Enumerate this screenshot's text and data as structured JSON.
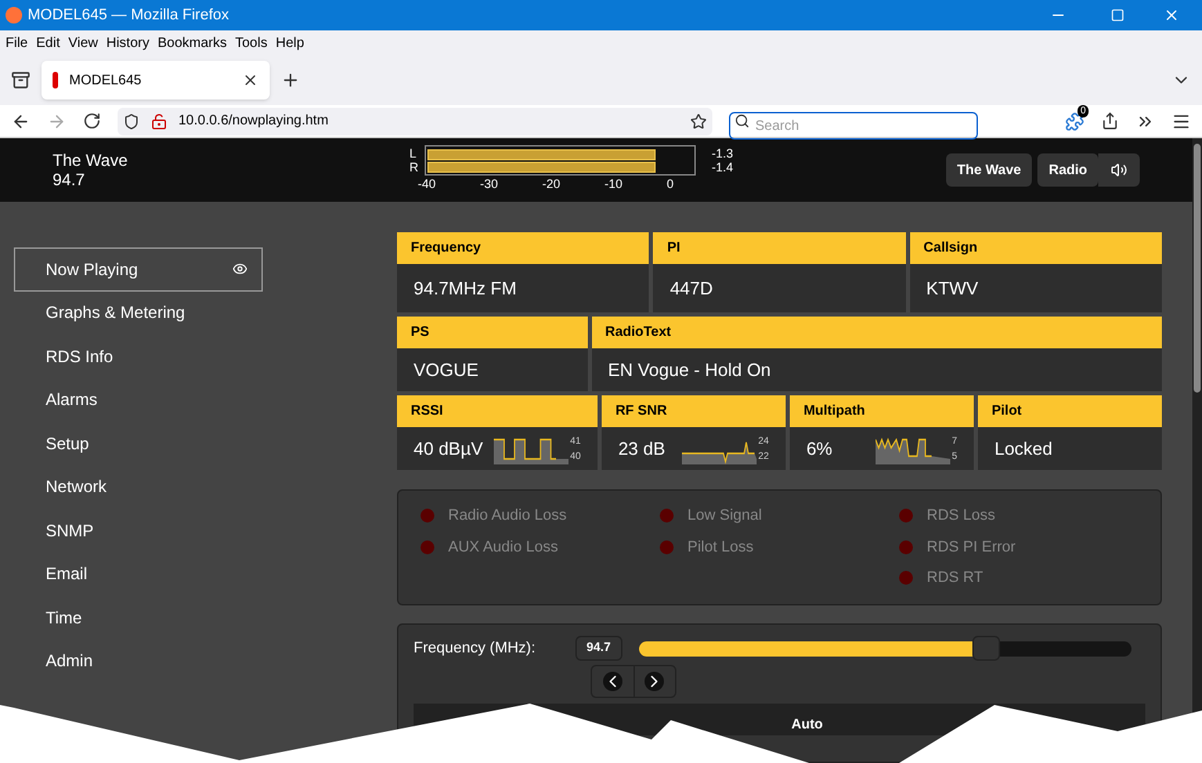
{
  "window": {
    "title": "MODEL645 — Mozilla Firefox"
  },
  "menu": [
    "File",
    "Edit",
    "View",
    "History",
    "Bookmarks",
    "Tools",
    "Help"
  ],
  "tabs": [
    {
      "label": "MODEL645",
      "selected": true
    }
  ],
  "address": {
    "url": "10.0.0.6/nowplaying.htm"
  },
  "search": {
    "placeholder": "Search"
  },
  "extension_badge": "0",
  "header": {
    "station": "The Wave",
    "frequency": "94.7",
    "meter": {
      "channels": [
        {
          "label": "L",
          "level": 0.86,
          "reading": "-1.3"
        },
        {
          "label": "R",
          "level": 0.86,
          "reading": "-1.4"
        }
      ],
      "ticks": [
        "-40",
        "-30",
        "-20",
        "-10",
        "0"
      ]
    },
    "buttons": [
      {
        "kind": "text",
        "label": "The Wave"
      },
      {
        "kind": "text",
        "label": "Radio"
      },
      {
        "kind": "speaker"
      }
    ]
  },
  "sidebar": {
    "items": [
      {
        "label": "Now Playing",
        "selected": true
      },
      {
        "label": "Graphs & Metering",
        "selected": false
      },
      {
        "label": "RDS Info",
        "selected": false
      },
      {
        "label": "Alarms",
        "selected": false
      },
      {
        "label": "Setup",
        "selected": false
      },
      {
        "label": "Network",
        "selected": false
      },
      {
        "label": "SNMP",
        "selected": false
      },
      {
        "label": "Email",
        "selected": false
      },
      {
        "label": "Time",
        "selected": false
      },
      {
        "label": "Admin",
        "selected": false
      }
    ]
  },
  "info_rows": [
    [
      {
        "title": "Frequency",
        "value": "94.7MHz FM"
      },
      {
        "title": "PI",
        "value": "447D"
      },
      {
        "title": "Callsign",
        "value": "KTWV"
      }
    ],
    [
      {
        "title": "PS",
        "value": "VOGUE"
      },
      {
        "title": "RadioText",
        "value": "EN Vogue - Hold On"
      }
    ],
    [
      {
        "title": "RSSI",
        "value": "40 dBµV",
        "max": "41",
        "min": "40"
      },
      {
        "title": "RF SNR",
        "value": "23 dB",
        "max": "24",
        "min": "22"
      },
      {
        "title": "Multipath",
        "value": "6%",
        "max": "7",
        "min": "5"
      },
      {
        "title": "Pilot",
        "value": "Locked"
      }
    ]
  ],
  "alarms": [
    [
      {
        "label": "Radio Audio Loss",
        "active": false
      },
      {
        "label": "AUX Audio Loss",
        "active": false
      }
    ],
    [
      {
        "label": "Low Signal",
        "active": false
      },
      {
        "label": "Pilot Loss",
        "active": false
      }
    ],
    [
      {
        "label": "RDS Loss",
        "active": false
      },
      {
        "label": "RDS PI Error",
        "active": false
      },
      {
        "label": "RDS RT",
        "active": false
      }
    ]
  ],
  "tuner": {
    "label": "Frequency (MHz):",
    "value": "94.7",
    "level": 0.69,
    "button": "Auto"
  }
}
